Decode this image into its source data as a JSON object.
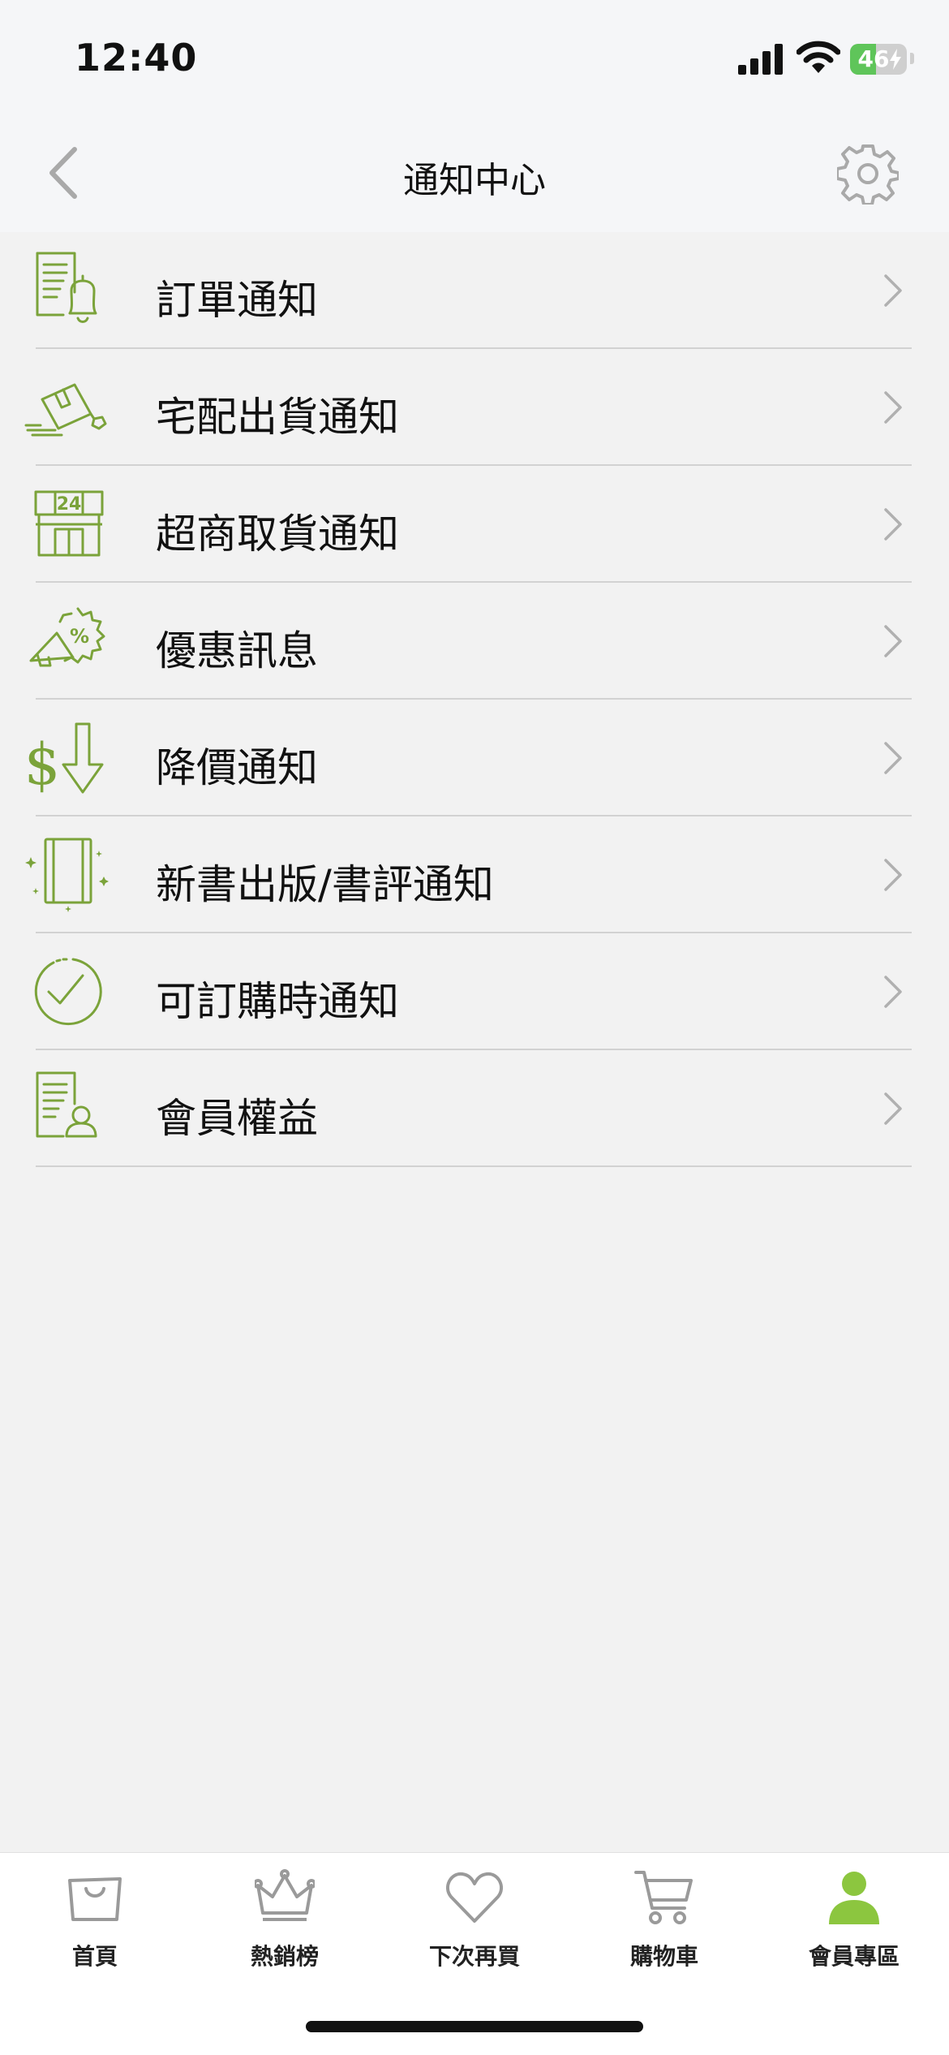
{
  "status_bar": {
    "time": "12:40",
    "battery_percent": 46,
    "battery_text": "46",
    "icons": [
      "cellular-signal-icon",
      "wifi-icon",
      "battery-charging-icon"
    ]
  },
  "nav": {
    "title": "通知中心",
    "back_icon": "chevron-left-icon",
    "settings_icon": "gear-icon"
  },
  "notification_items": [
    {
      "label": "訂單通知",
      "icon": "order-bell-icon"
    },
    {
      "label": "宅配出貨通知",
      "icon": "delivery-box-icon"
    },
    {
      "label": "超商取貨通知",
      "icon": "convenience-store-24-icon"
    },
    {
      "label": "優惠訊息",
      "icon": "promo-megaphone-icon"
    },
    {
      "label": "降價通知",
      "icon": "price-drop-icon"
    },
    {
      "label": "新書出版/書評通知",
      "icon": "new-book-icon"
    },
    {
      "label": "可訂購時通知",
      "icon": "check-circle-icon"
    },
    {
      "label": "會員權益",
      "icon": "member-document-icon"
    }
  ],
  "tab_bar": {
    "active_index": 4,
    "tabs": [
      {
        "label": "首頁",
        "icon": "shopping-bag-icon"
      },
      {
        "label": "熱銷榜",
        "icon": "crown-icon"
      },
      {
        "label": "下次再買",
        "icon": "heart-icon"
      },
      {
        "label": "購物車",
        "icon": "cart-icon"
      },
      {
        "label": "會員專區",
        "icon": "person-icon"
      }
    ]
  },
  "colors": {
    "accent_green": "#7ba33a",
    "tab_active": "#8cc63f",
    "tab_inactive": "#9a9a9a",
    "chevron": "#b0b0b0",
    "background": "#f2f2f2"
  }
}
